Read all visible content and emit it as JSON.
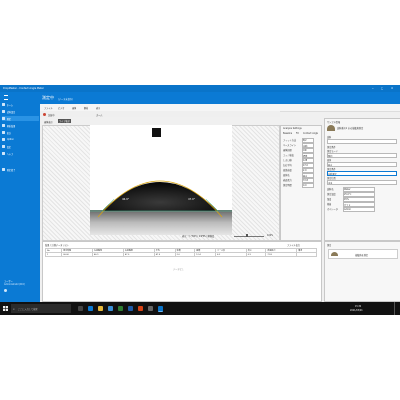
{
  "window": {
    "title": "DropMaster - Contact Angle Meter",
    "minimize_glyph": "─",
    "maximize_glyph": "□",
    "close_glyph": "✕"
  },
  "header": {
    "page_title": "測定中",
    "subtitle": "(データ未保存)"
  },
  "sidebar": {
    "items": [
      {
        "label": "ホーム"
      },
      {
        "label": "試料設定"
      },
      {
        "label": "測定"
      },
      {
        "label": "解析結果"
      },
      {
        "label": "統計"
      },
      {
        "label": "Option"
      },
      {
        "label": "設定"
      },
      {
        "label": "ヘルプ"
      },
      {
        "label": "測定終了"
      }
    ],
    "footer_label": "ユーザー",
    "footer_sub": "Administrator(DCC)"
  },
  "toolbar": {
    "row1": [
      "ファイル",
      "ビデオ",
      "画像",
      "解析",
      "表示"
    ],
    "row2_status": "記録中",
    "row2_zoom": "ズーム"
  },
  "image_tab": {
    "label": "画像表示",
    "live_label": "ライブ表示"
  },
  "measurement": {
    "left_angle": "46.9°",
    "right_angle": "47.0°",
    "status_text": "表示：Y (TOP) / 24FPS / 解像度",
    "zoom_value": "100%"
  },
  "analysis_panel": {
    "title": "Analysis Settings",
    "tabs": [
      "Baseline",
      "Fit",
      "Contact Angle"
    ],
    "rows": [
      {
        "label": "フィット方法",
        "value": "θ/2"
      },
      {
        "label": "ベースライン",
        "value": "自動"
      },
      {
        "label": "画像処理",
        "value": "ON"
      },
      {
        "label": "エッジ検出",
        "value": "標準"
      },
      {
        "label": "しきい値",
        "value": "128"
      },
      {
        "label": "左右平均",
        "value": "47.0"
      },
      {
        "label": "液滴容量",
        "value": "2.0"
      },
      {
        "label": "液体名",
        "value": "純水"
      },
      {
        "label": "表面張力",
        "value": "72.8"
      },
      {
        "label": "測定時間",
        "value": "0.0"
      }
    ]
  },
  "right_panel": {
    "title": "サンプル情報",
    "sample_label": "試料",
    "sample_id": "試料番号1 水の接触角測定",
    "measurement_label": "測定条件",
    "fields": [
      {
        "label": "測定モード",
        "value": "静的"
      },
      {
        "label": "液体",
        "value": "純水"
      },
      {
        "label": "測定条件",
        "value": "自動測定"
      },
      {
        "label": "測定位置",
        "value": "中央"
      }
    ],
    "secondary_fields": [
      {
        "label": "試料名",
        "value": "Water"
      },
      {
        "label": "測定温度",
        "value": "25.0℃"
      },
      {
        "label": "湿度",
        "value": "45%"
      },
      {
        "label": "基板",
        "value": "ガラス"
      },
      {
        "label": "オペレータ",
        "value": "Admin"
      }
    ],
    "summary_title": "測定",
    "summary_button": "接触角を測定"
  },
  "results": {
    "title": "結果 / 計測データリスト",
    "toolbar_label": "ファイル出力",
    "columns": [
      "No",
      "測定時間",
      "左接触角",
      "右接触角",
      "平均",
      "体積",
      "面積",
      "ベース長",
      "高さ",
      "表面張力",
      "備考"
    ],
    "row": [
      "1",
      "00:00",
      "46.9",
      "47.0",
      "47.0",
      "2.0",
      "12.4",
      "4.2",
      "0.9",
      "72.8",
      ""
    ],
    "empty_text": "データなし"
  },
  "taskbar": {
    "search_placeholder": "ここに入力して検索",
    "time": "15:34",
    "date": "2021/03/01"
  },
  "colors": {
    "accent": "#0b7ad4",
    "taskbar": "#111111",
    "contact_line": "#d9a40d"
  }
}
